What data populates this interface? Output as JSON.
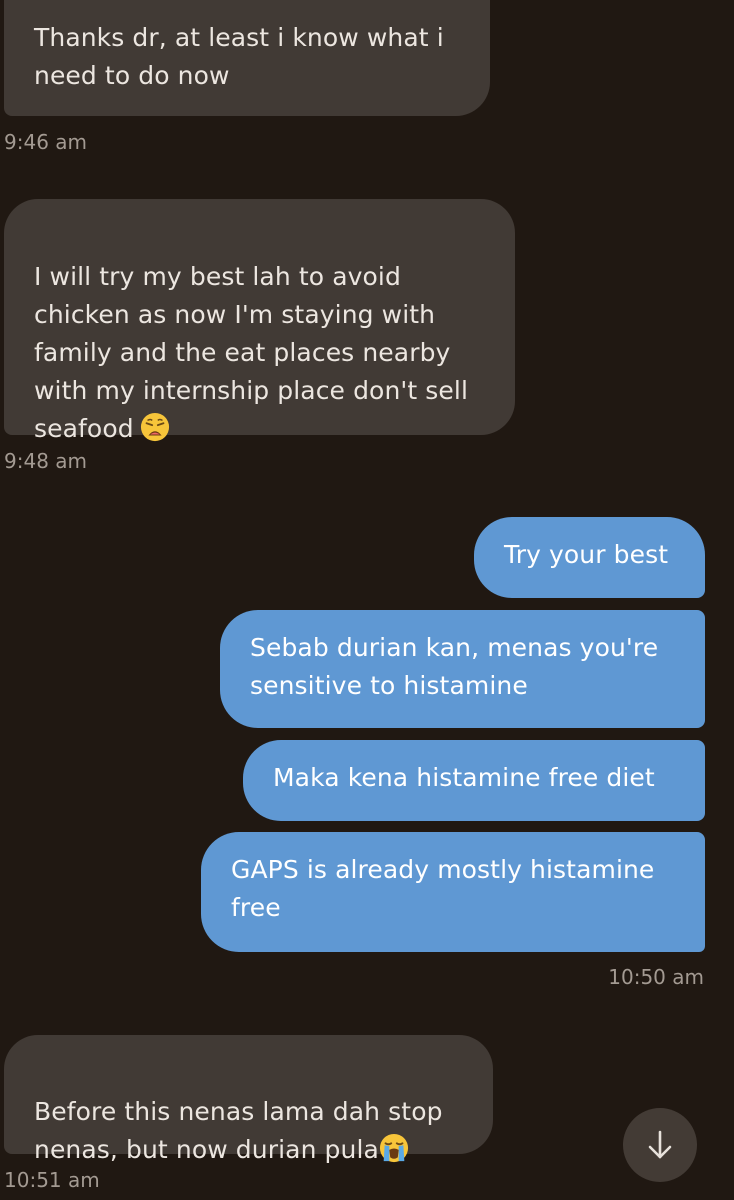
{
  "messages": [
    {
      "direction": "incoming",
      "text": "Thanks dr, at least i know what i\nneed to do now"
    },
    {
      "direction": "incoming",
      "text": "I will try my best lah to avoid\nchicken as now I'm staying with\nfamily and the eat places nearby\nwith my internship place don't sell\nseafood",
      "emoji": "weary-face"
    },
    {
      "direction": "outgoing",
      "text": "Try your best"
    },
    {
      "direction": "outgoing",
      "text": "Sebab durian kan, menas you're\nsensitive to histamine"
    },
    {
      "direction": "outgoing",
      "text": "Maka kena histamine free diet"
    },
    {
      "direction": "outgoing",
      "text": "GAPS is already mostly histamine\nfree"
    },
    {
      "direction": "incoming",
      "text": "Before this nenas lama dah stop\nnenas, but now durian pula",
      "emoji": "loudly-crying-face"
    }
  ],
  "timestamps": [
    "9:46 am",
    "9:48 am",
    "10:50 am",
    "10:51 am"
  ],
  "scroll_button": {
    "icon": "arrow-down-icon"
  },
  "colors": {
    "background": "#201812",
    "incoming_bubble": "#413a35",
    "outgoing_bubble": "#5f98d3",
    "timestamp": "#a39a92"
  }
}
